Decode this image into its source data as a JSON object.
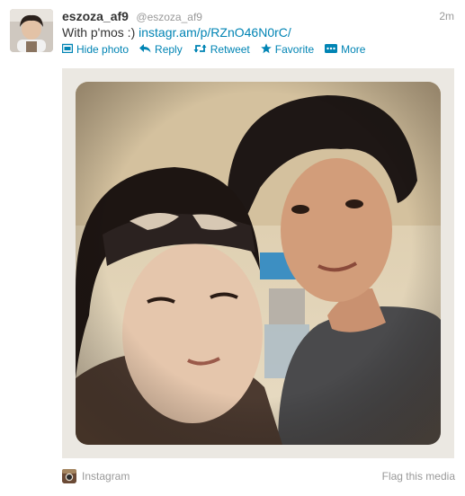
{
  "tweet": {
    "fullname": "eszoza_af9",
    "screenname": "@eszoza_af9",
    "timestamp": "2m",
    "text_prefix": "With p'mos :) ",
    "link_text": "instagr.am/p/RZnO46N0rC/"
  },
  "actions": [
    {
      "label": "Hide photo",
      "icon": "photo-icon"
    },
    {
      "label": "Reply",
      "icon": "reply-arrow-icon"
    },
    {
      "label": "Retweet",
      "icon": "retweet-icon"
    },
    {
      "label": "Favorite",
      "icon": "star-icon"
    },
    {
      "label": "More",
      "icon": "more-dots-icon"
    }
  ],
  "media": {
    "source_label": "Instagram",
    "flag_label": "Flag this media"
  },
  "colors": {
    "link": "#0084b4",
    "muted": "#999999",
    "frame": "#ebe8e2"
  }
}
